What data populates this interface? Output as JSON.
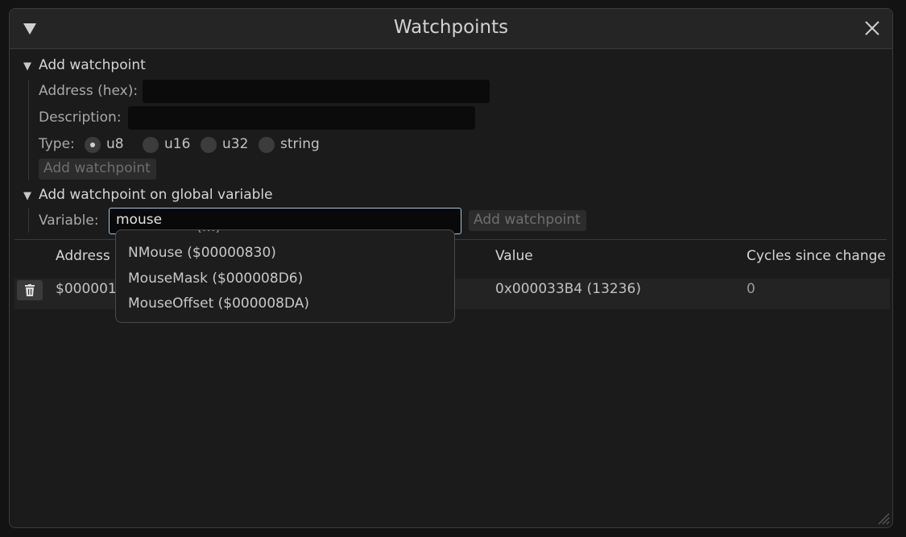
{
  "window": {
    "title": "Watchpoints"
  },
  "add_section": {
    "header": "Add watchpoint",
    "address_label": "Address (hex):",
    "address_value": "",
    "description_label": "Description:",
    "description_value": "",
    "type_label": "Type:",
    "types": [
      "u8",
      "u16",
      "u32",
      "string"
    ],
    "selected_type": "u8",
    "add_button": "Add watchpoint"
  },
  "global_section": {
    "header": "Add watchpoint on global variable",
    "variable_label": "Variable:",
    "variable_value": "mouse",
    "add_button": "Add watchpoint"
  },
  "table": {
    "columns": [
      "Address",
      "Value",
      "Cycles since change"
    ],
    "rows": [
      {
        "address": "$000001",
        "value": "0x000033B4 (13236)",
        "cycles": "0"
      }
    ]
  },
  "autocomplete": {
    "partial_item": "(…)",
    "items": [
      "NMouse ($00000830)",
      "MouseMask ($000008D6)",
      "MouseOffset ($000008DA)"
    ]
  },
  "icons": [
    "collapse-triangle-icon",
    "close-icon",
    "trash-icon",
    "resize-grip-icon"
  ]
}
